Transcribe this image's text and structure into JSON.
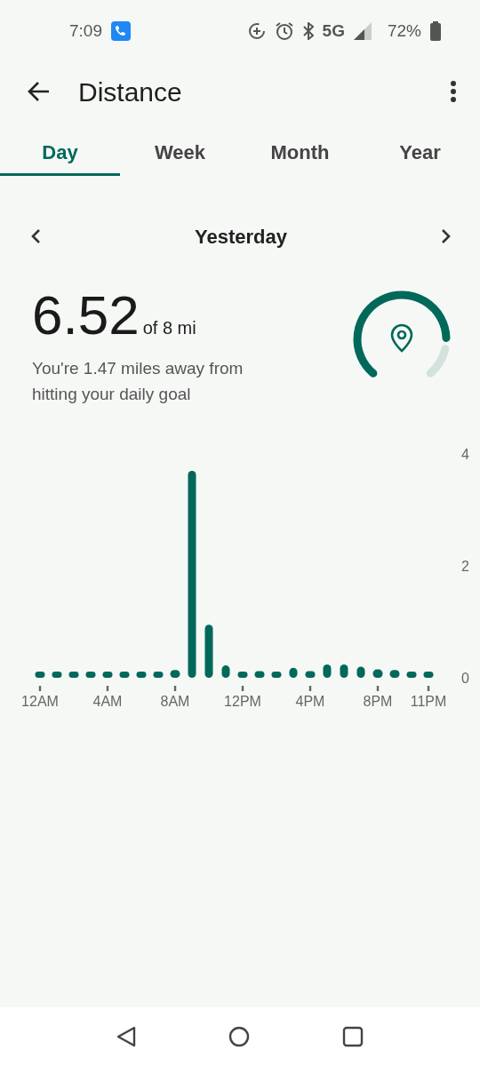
{
  "status_bar": {
    "time": "7:09",
    "network": "5G",
    "battery": "72%"
  },
  "app_bar": {
    "title": "Distance"
  },
  "tabs": [
    {
      "label": "Day",
      "selected": true
    },
    {
      "label": "Week",
      "selected": false
    },
    {
      "label": "Month",
      "selected": false
    },
    {
      "label": "Year",
      "selected": false
    }
  ],
  "date_nav": {
    "label": "Yesterday"
  },
  "summary": {
    "value": "6.52",
    "goal": "of 8 mi",
    "message": "You're 1.47 miles away from hitting your daily goal"
  },
  "chart": {
    "chart_data": {
      "type": "bar",
      "categories": [
        "12AM",
        null,
        null,
        null,
        "4AM",
        null,
        null,
        null,
        "8AM",
        null,
        null,
        null,
        "12PM",
        null,
        null,
        null,
        "4PM",
        null,
        null,
        null,
        "8PM",
        null,
        null,
        "11PM"
      ],
      "series": [
        {
          "color": "#00695a",
          "values": [
            0.11,
            0.11,
            0.11,
            0.11,
            0.11,
            0.11,
            0.11,
            0.11,
            0.14,
            3.7,
            0.95,
            0.22,
            0.11,
            0.12,
            0.11,
            0.18,
            0.12,
            0.24,
            0.24,
            0.2,
            0.15,
            0.14,
            0.11,
            0.11
          ]
        }
      ],
      "yticks": [
        0,
        2,
        4
      ],
      "ylim": [
        0,
        4
      ]
    }
  }
}
